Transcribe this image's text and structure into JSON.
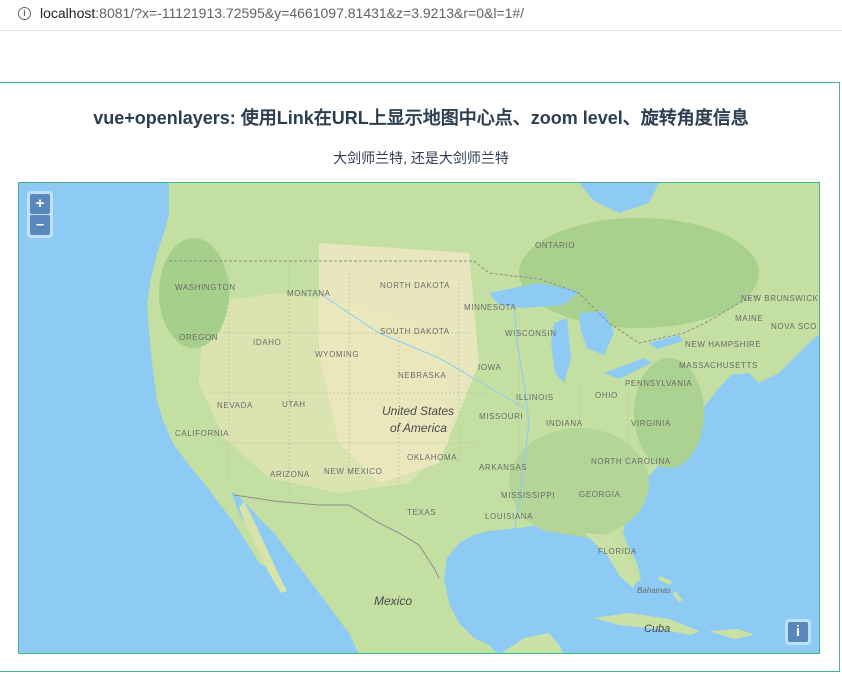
{
  "browser": {
    "url_host": "localhost",
    "url_rest": ":8081/?x=-11121913.72595&y=4661097.81431&z=3.9213&r=0&l=1#/"
  },
  "page": {
    "title": "vue+openlayers: 使用Link在URL上显示地图中心点、zoom level、旋转角度信息",
    "subtitle": "大剑师兰特, 还是大剑师兰特"
  },
  "map": {
    "zoom_in": "+",
    "zoom_out": "–",
    "attribution": "i",
    "country_labels": {
      "usa_line1": "United States",
      "usa_line2": "of America",
      "mexico": "Mexico",
      "bahamas": "Bahamas",
      "cuba": "Cuba"
    },
    "region_labels": {
      "washington": "WASHINGTON",
      "oregon": "OREGON",
      "california": "CALIFORNIA",
      "nevada": "NEVADA",
      "idaho": "IDAHO",
      "montana": "MONTANA",
      "wyoming": "WYOMING",
      "utah": "UTAH",
      "arizona": "ARIZONA",
      "new_mexico": "NEW MEXICO",
      "north_dakota": "NORTH DAKOTA",
      "south_dakota": "SOUTH DAKOTA",
      "nebraska": "NEBRASKA",
      "oklahoma": "OKLAHOMA",
      "texas": "TEXAS",
      "minnesota": "MINNESOTA",
      "wisconsin": "WISCONSIN",
      "iowa": "IOWA",
      "illinois": "ILLINOIS",
      "missouri": "MISSOURI",
      "arkansas": "ARKANSAS",
      "louisiana": "LOUISIANA",
      "mississippi": "MISSISSIPPI",
      "indiana": "INDIANA",
      "ohio": "OHIO",
      "georgia": "GEORGIA",
      "florida": "FLORIDA",
      "north_carolina": "NORTH CAROLINA",
      "virginia": "VIRGINIA",
      "pennsylvania": "PENNSYLVANIA",
      "new_hampshire": "NEW HAMPSHIRE",
      "massachusetts": "MASSACHUSETTS",
      "maine": "MAINE",
      "new_brunswick": "NEW BRUNSWICK",
      "nova_scotia": "NOVA SCO",
      "ontario": "ONTARIO"
    }
  }
}
